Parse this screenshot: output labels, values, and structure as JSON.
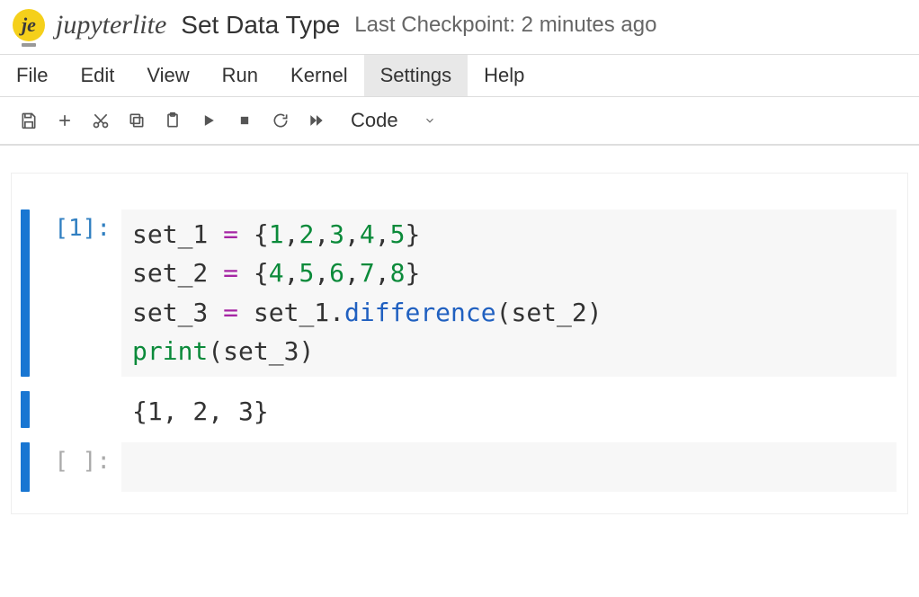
{
  "header": {
    "logo_glyph": "je",
    "logo_text": "jupyterlite",
    "title": "Set Data Type",
    "checkpoint": "Last Checkpoint: 2 minutes ago"
  },
  "menu": {
    "items": [
      "File",
      "Edit",
      "View",
      "Run",
      "Kernel",
      "Settings",
      "Help"
    ],
    "highlighted_index": 5
  },
  "toolbar": {
    "cell_type": "Code"
  },
  "cells": [
    {
      "execution_count": 1,
      "prompt": "[1]:",
      "code_tokens": [
        [
          {
            "t": "name",
            "v": "set_1"
          },
          {
            "t": "sp",
            "v": " "
          },
          {
            "t": "op",
            "v": "="
          },
          {
            "t": "sp",
            "v": " "
          },
          {
            "t": "punc",
            "v": "{"
          },
          {
            "t": "num",
            "v": "1"
          },
          {
            "t": "punc",
            "v": ","
          },
          {
            "t": "num",
            "v": "2"
          },
          {
            "t": "punc",
            "v": ","
          },
          {
            "t": "num",
            "v": "3"
          },
          {
            "t": "punc",
            "v": ","
          },
          {
            "t": "num",
            "v": "4"
          },
          {
            "t": "punc",
            "v": ","
          },
          {
            "t": "num",
            "v": "5"
          },
          {
            "t": "punc",
            "v": "}"
          }
        ],
        [
          {
            "t": "name",
            "v": "set_2"
          },
          {
            "t": "sp",
            "v": " "
          },
          {
            "t": "op",
            "v": "="
          },
          {
            "t": "sp",
            "v": " "
          },
          {
            "t": "punc",
            "v": "{"
          },
          {
            "t": "num",
            "v": "4"
          },
          {
            "t": "punc",
            "v": ","
          },
          {
            "t": "num",
            "v": "5"
          },
          {
            "t": "punc",
            "v": ","
          },
          {
            "t": "num",
            "v": "6"
          },
          {
            "t": "punc",
            "v": ","
          },
          {
            "t": "num",
            "v": "7"
          },
          {
            "t": "punc",
            "v": ","
          },
          {
            "t": "num",
            "v": "8"
          },
          {
            "t": "punc",
            "v": "}"
          }
        ],
        [
          {
            "t": "name",
            "v": "set_3"
          },
          {
            "t": "sp",
            "v": " "
          },
          {
            "t": "op",
            "v": "="
          },
          {
            "t": "sp",
            "v": " "
          },
          {
            "t": "name",
            "v": "set_1"
          },
          {
            "t": "punc",
            "v": "."
          },
          {
            "t": "meth",
            "v": "difference"
          },
          {
            "t": "punc",
            "v": "("
          },
          {
            "t": "name",
            "v": "set_2"
          },
          {
            "t": "punc",
            "v": ")"
          }
        ],
        [
          {
            "t": "func",
            "v": "print"
          },
          {
            "t": "punc",
            "v": "("
          },
          {
            "t": "name",
            "v": "set_3"
          },
          {
            "t": "punc",
            "v": ")"
          }
        ]
      ],
      "output": "{1, 2, 3}"
    },
    {
      "execution_count": null,
      "prompt": "[ ]:",
      "code_tokens": [
        []
      ],
      "output": null
    }
  ]
}
